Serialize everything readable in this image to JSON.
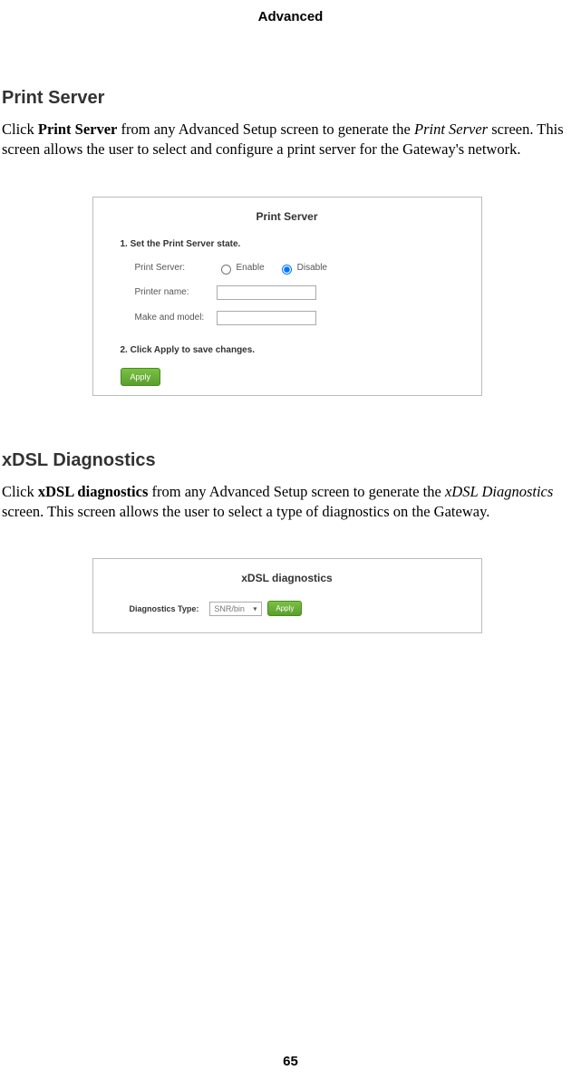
{
  "header": "Advanced",
  "page_number": "65",
  "section1": {
    "heading": "Print Server",
    "para_pre": "Click ",
    "para_bold": "Print Server",
    "para_mid": " from any Advanced Setup screen to generate the ",
    "para_italic": "Print Server",
    "para_post": " screen. This screen allows the user to select and configure a print server for the Gateway's network."
  },
  "shot1": {
    "title": "Print Server",
    "step1": "1. Set the Print Server state.",
    "row1_label": "Print Server:",
    "enable": "Enable",
    "disable": "Disable",
    "row2_label": "Printer name:",
    "row3_label": "Make and model:",
    "step2": "2. Click Apply to save changes.",
    "apply": "Apply"
  },
  "section2": {
    "heading": "xDSL Diagnostics",
    "para_pre": "Click ",
    "para_bold": "xDSL diagnostics",
    "para_mid": " from any Advanced Setup screen to generate the ",
    "para_italic": "xDSL Diagnostics",
    "para_post": " screen. This screen allows the user to select a type of diagnostics on the Gateway."
  },
  "shot2": {
    "title": "xDSL diagnostics",
    "diag_label": "Diagnostics Type:",
    "diag_value": "SNR/bin",
    "apply": "Apply"
  }
}
